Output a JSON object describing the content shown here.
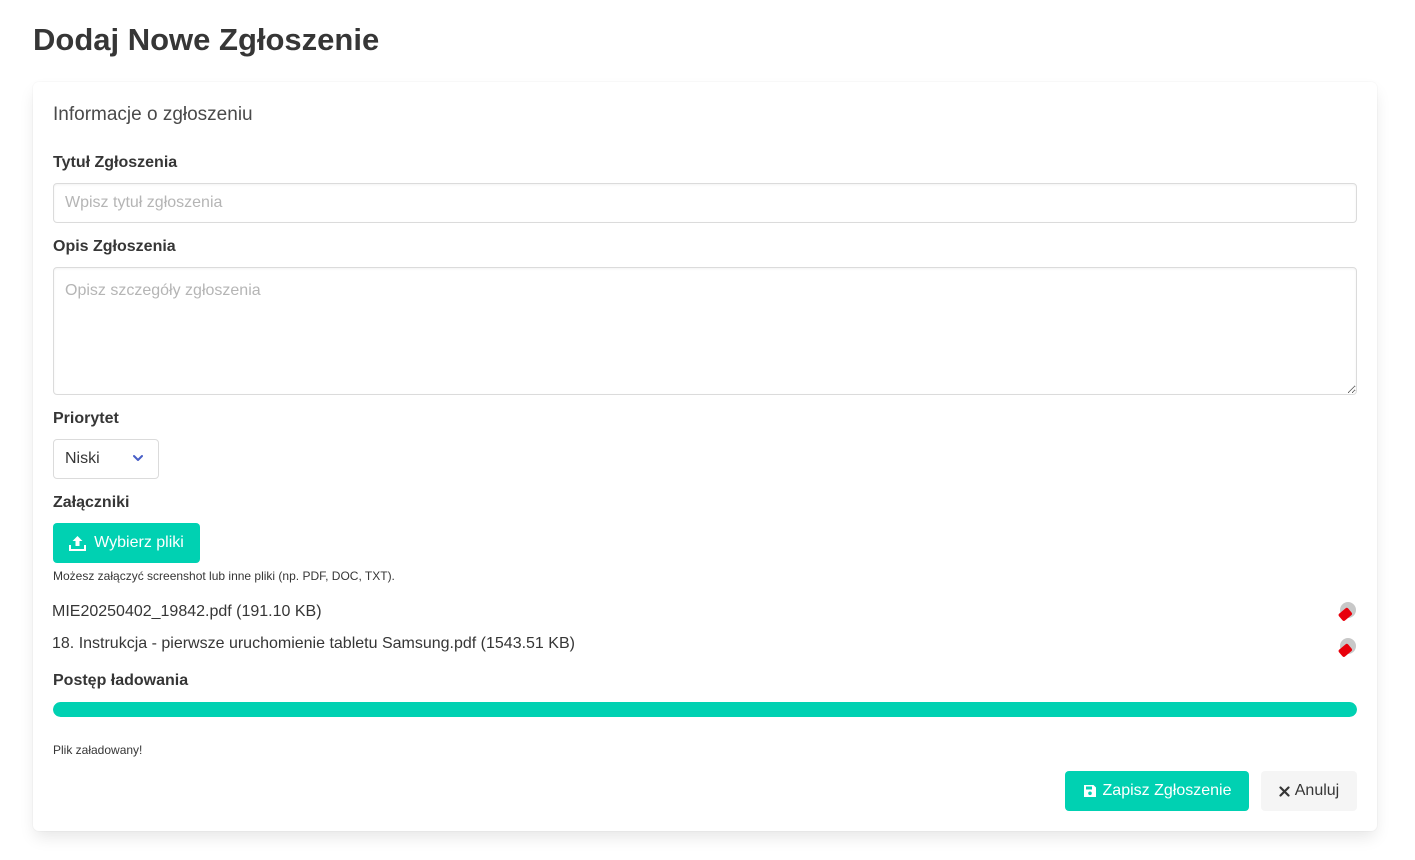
{
  "page": {
    "title": "Dodaj Nowe Zgłoszenie"
  },
  "card": {
    "subtitle": "Informacje o zgłoszeniu"
  },
  "form": {
    "title": {
      "label": "Tytuł Zgłoszenia",
      "value": "",
      "placeholder": "Wpisz tytuł zgłoszenia"
    },
    "description": {
      "label": "Opis Zgłoszenia",
      "value": "",
      "placeholder": "Opisz szczegóły zgłoszenia"
    },
    "priority": {
      "label": "Priorytet",
      "selected": "Niski",
      "icon": "chevron-down-icon",
      "icon_color": "#485fc7"
    },
    "attachments": {
      "label": "Załączniki",
      "upload_label": "Wybierz pliki",
      "upload_icon": "upload-icon",
      "help": "Możesz załączyć screenshot lub inne pliki (np. PDF, DOC, TXT).",
      "files": [
        {
          "name": "MIE20250402_19842.pdf (191.10 KB)",
          "icon": "delete-file-icon"
        },
        {
          "name": "18. Instrukcja - pierwsze uruchomienie tabletu Samsung.pdf (1543.51 KB)",
          "icon": "delete-file-icon"
        }
      ]
    },
    "progress": {
      "label": "Postęp ładowania",
      "percent": 100,
      "status": "Plik załadowany!"
    }
  },
  "actions": {
    "save_label": "Zapisz Zgłoszenie",
    "save_icon": "save-icon",
    "cancel_label": "Anuluj",
    "cancel_icon": "close-icon"
  },
  "colors": {
    "primary": "#00d1b2",
    "delete": "#e8000b",
    "text": "#363636"
  }
}
